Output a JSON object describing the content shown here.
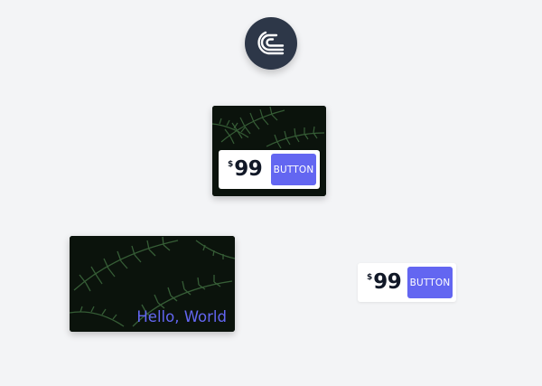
{
  "logo": {
    "icon": "swirl-logo-icon",
    "background": "#2d3748",
    "stroke": "#ffffff"
  },
  "colors": {
    "page_bg": "#f3f4f6",
    "accent": "#6366f1",
    "text_dark": "#111827",
    "image_dark": "#0b130c",
    "fern_green": "#3e6a3e"
  },
  "top_card": {
    "image": "fern-leaves-image",
    "price": {
      "currency": "$",
      "amount": "99"
    },
    "button_label": "BUTTON"
  },
  "hero_card": {
    "image": "fern-leaves-image",
    "caption": "Hello, World"
  },
  "standalone_price": {
    "price": {
      "currency": "$",
      "amount": "99"
    },
    "button_label": "BUTTON"
  }
}
